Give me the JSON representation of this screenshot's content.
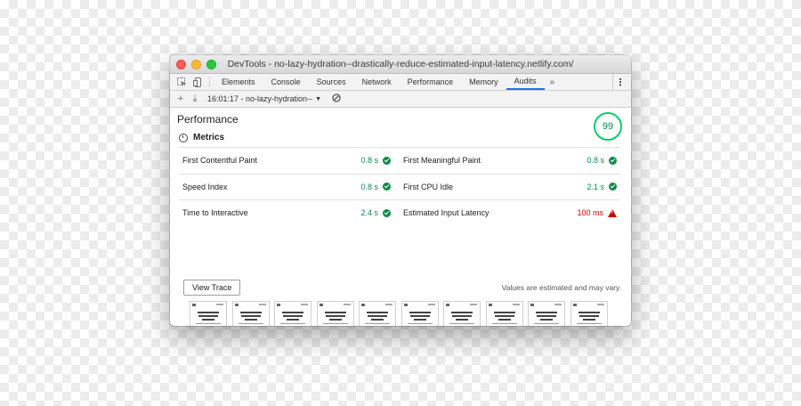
{
  "window": {
    "title": "DevTools - no-lazy-hydration--drastically-reduce-estimated-input-latency.netlify.com/"
  },
  "tabs": [
    {
      "label": "Elements"
    },
    {
      "label": "Console"
    },
    {
      "label": "Sources"
    },
    {
      "label": "Network"
    },
    {
      "label": "Performance"
    },
    {
      "label": "Memory"
    },
    {
      "label": "Audits",
      "active": true
    }
  ],
  "tabs_overflow": "»",
  "kebab": "⋮",
  "toolbar": {
    "add": "+",
    "download": "⤓",
    "report_label": "16:01:17 - no-lazy-hydration--",
    "report_caret": "▼",
    "clear": "⃠"
  },
  "report": {
    "category_title": "Performance",
    "score": "99",
    "metrics_heading": "Metrics",
    "metrics": [
      {
        "name": "First Contentful Paint",
        "value": "0.8 s",
        "status": "pass"
      },
      {
        "name": "First Meaningful Paint",
        "value": "0.8 s",
        "status": "pass"
      },
      {
        "name": "Speed Index",
        "value": "0.8 s",
        "status": "pass"
      },
      {
        "name": "First CPU Idle",
        "value": "2.1 s",
        "status": "pass"
      },
      {
        "name": "Time to Interactive",
        "value": "2.4 s",
        "status": "pass"
      },
      {
        "name": "Estimated Input Latency",
        "value": "100 ms",
        "status": "fail"
      }
    ],
    "view_trace_label": "View Trace",
    "estimate_note": "Values are estimated and may vary.",
    "filmstrip_frames": 10
  },
  "colors": {
    "pass": "#0a8a47",
    "fail": "#cc0000",
    "score_ring": "#0cce6b",
    "active_tab": "#1a73e8"
  }
}
